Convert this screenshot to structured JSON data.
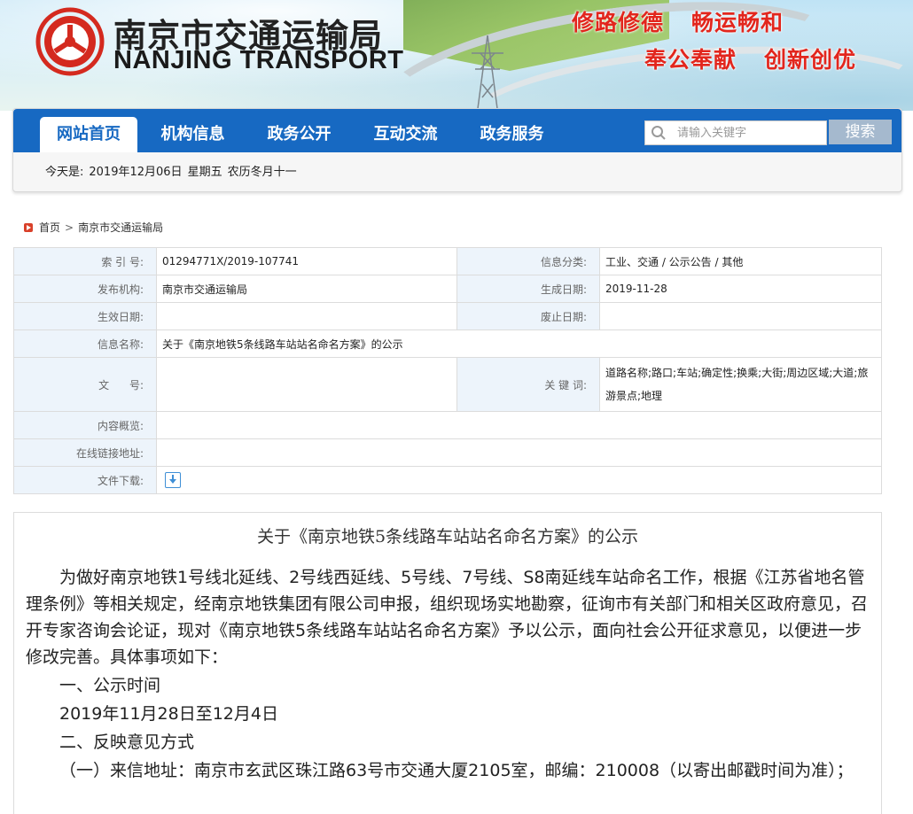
{
  "header": {
    "title_cn": "南京市交通运输局",
    "title_en": "NANJING TRANSPORT",
    "slogans": [
      "修路修德",
      "畅运畅和",
      "奉公奉献",
      "创新创优"
    ],
    "brand_color": "#e2261d"
  },
  "nav": {
    "items": [
      "网站首页",
      "机构信息",
      "政务公开",
      "互动交流",
      "政务服务"
    ],
    "active": "网站首页",
    "search_placeholder": "请输入关键字",
    "search_button": "搜索",
    "accent": "#1769c2"
  },
  "today": {
    "label": "今天是:",
    "date": "2019年12月06日",
    "weekday": "星期五",
    "lunar": "农历冬月十一"
  },
  "breadcrumb": {
    "home": "首页",
    "current": "南京市交通运输局"
  },
  "info_table": {
    "index_label": "索 引 号:",
    "index_value": "01294771X/2019-107741",
    "category_label": "信息分类:",
    "category_value": "工业、交通 / 公示公告 / 其他",
    "publisher_label": "发布机构:",
    "publisher_value": "南京市交通运输局",
    "created_label": "生成日期:",
    "created_value": "2019-11-28",
    "effective_label": "生效日期:",
    "effective_value": "",
    "expiry_label": "废止日期:",
    "expiry_value": "",
    "name_label": "信息名称:",
    "name_value": "关于《南京地铁5条线路车站站名命名方案》的公示",
    "docno_label": "文      号:",
    "docno_value": "",
    "keywords_label": "关 键 词:",
    "keywords_value": "道路名称;路口;车站;确定性;换乘;大街;周边区域;大道;旅游景点;地理",
    "overview_label": "内容概览:",
    "overview_value": "",
    "link_label": "在线链接地址:",
    "link_value": "",
    "download_label": "文件下载:"
  },
  "article": {
    "title": "关于《南京地铁5条线路车站站名命名方案》的公示",
    "paragraphs": [
      "为做好南京地铁1号线北延线、2号线西延线、5号线、7号线、S8南延线车站命名工作，根据《江苏省地名管理条例》等相关规定，经南京地铁集团有限公司申报，组织现场实地勘察，征询市有关部门和相关区政府意见，召开专家咨询会论证，现对《南京地铁5条线路车站站名命名方案》予以公示，面向社会公开征求意见，以便进一步修改完善。具体事项如下：",
      "一、公示时间",
      "2019年11月28日至12月4日",
      "二、反映意见方式",
      "（一）来信地址：南京市玄武区珠江路63号市交通大厦2105室，邮编：210008（以寄出邮戳时间为准）；"
    ]
  }
}
